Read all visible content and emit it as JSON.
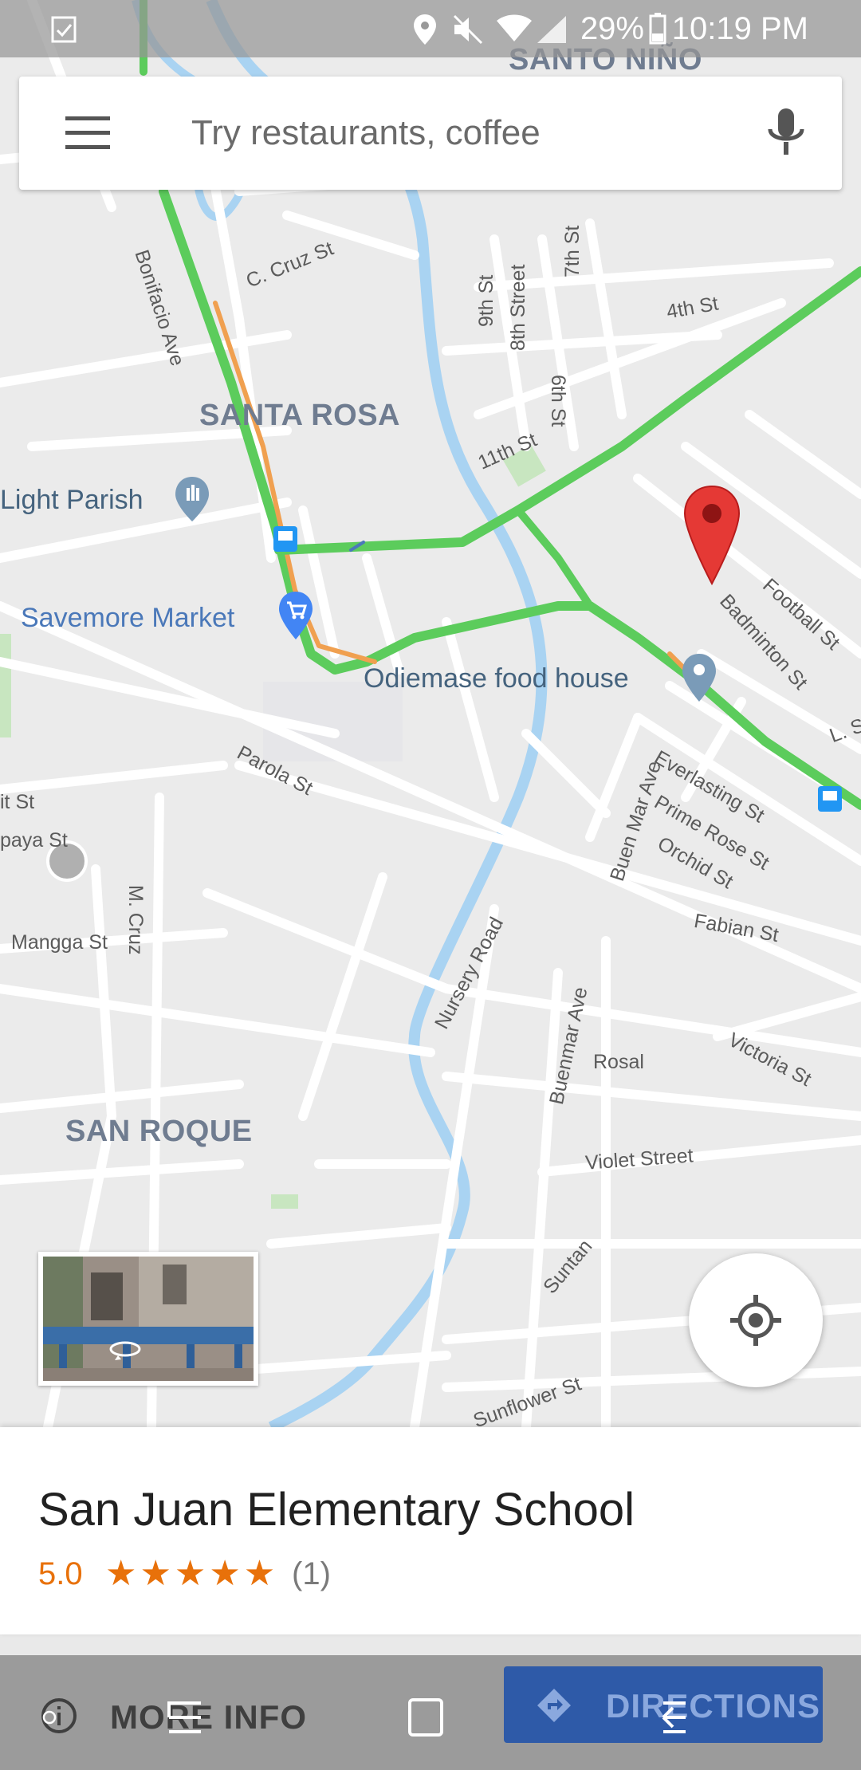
{
  "status_bar": {
    "battery": "29%",
    "time": "10:19 PM"
  },
  "search": {
    "placeholder": "Try restaurants, coffee"
  },
  "map": {
    "areas": {
      "santo_nino": "SANTO NIÑO",
      "santa_rosa": "SANTA ROSA",
      "san_roque": "SAN ROQUE"
    },
    "streets": {
      "c_cruz": "C. Cruz St",
      "bonifacio": "Bonifacio Ave",
      "fourth": "4th St",
      "seventh": "7th St",
      "eighth": "8th Street",
      "ninth": "9th St",
      "sixth": "6th St",
      "eleventh": "11th St",
      "football": "Football St",
      "badminton": "Badminton St",
      "parola": "Parola St",
      "everlasting": "Everlasting St",
      "prime_rose": "Prime Rose St",
      "orchid": "Orchid St",
      "buen_mar": "Buen Mar Ave",
      "fabian": "Fabian St",
      "m_cruz": "M. Cruz",
      "mangga": "Mangga St",
      "nursery": "Nursery Road",
      "buenmar": "Buenmar Ave",
      "rosal": "Rosal",
      "victoria": "Victoria St",
      "violet": "Violet Street",
      "suntan": "Suntan",
      "sunflower": "Sunflower St",
      "l_sa": "L. Sa",
      "it_st": "it St",
      "paya": "paya St"
    },
    "pois": {
      "parish": "Light Parish",
      "savemore": "Savemore Market",
      "odiemase": "Odiemase food house"
    }
  },
  "place": {
    "name": "San Juan Elementary School",
    "rating": "5.0",
    "stars": "★★★★★",
    "review_count": "(1)"
  },
  "actions": {
    "more_info": "MORE INFO",
    "directions": "DIRECTIONS"
  },
  "colors": {
    "accent": "#2e5aa8",
    "rating": "#e8710a",
    "traffic_green": "#5ccc5c",
    "traffic_orange": "#f0a050",
    "pin_red": "#d93025"
  }
}
